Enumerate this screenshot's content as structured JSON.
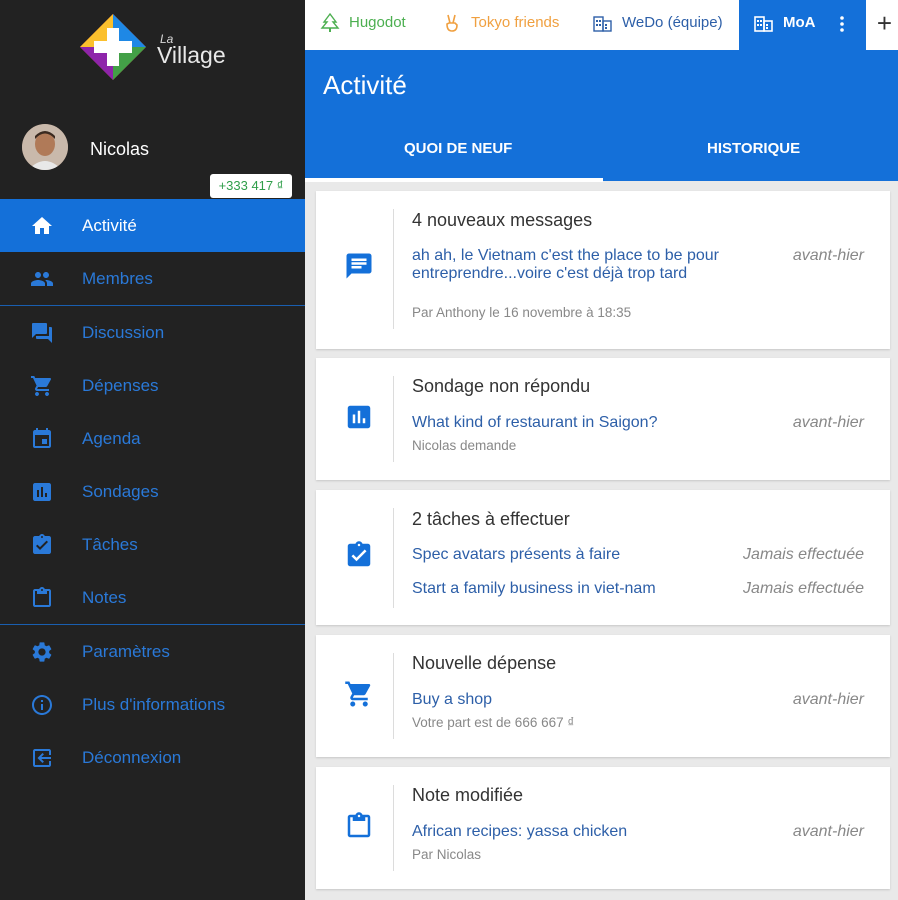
{
  "app": {
    "logo_small": "La",
    "logo_text": "Village"
  },
  "user": {
    "name": "Nicolas"
  },
  "sidebar": {
    "items": [
      {
        "label": "Activité",
        "icon": "home-icon"
      },
      {
        "label": "Membres",
        "icon": "people-icon"
      },
      {
        "label": "Discussion",
        "icon": "forum-icon"
      },
      {
        "label": "Dépenses",
        "icon": "cart-icon",
        "badge": "+333 417 ₫"
      },
      {
        "label": "Agenda",
        "icon": "calendar-icon"
      },
      {
        "label": "Sondages",
        "icon": "poll-icon"
      },
      {
        "label": "Tâches",
        "icon": "task-icon"
      },
      {
        "label": "Notes",
        "icon": "clipboard-icon"
      },
      {
        "label": "Paramètres",
        "icon": "gear-icon"
      },
      {
        "label": "Plus d'informations",
        "icon": "info-icon"
      },
      {
        "label": "Déconnexion",
        "icon": "logout-icon"
      }
    ]
  },
  "workspace_tabs": [
    {
      "label": "Hugodot",
      "color": "#4caf50",
      "icon": "tree-icon"
    },
    {
      "label": "Tokyo friends",
      "color": "#f0a040",
      "icon": "peace-hand-icon"
    },
    {
      "label": "WeDo (équipe)",
      "color": "#2d5fa8",
      "icon": "building-icon"
    },
    {
      "label": "MoA",
      "color": "#ffffff",
      "icon": "building-icon"
    }
  ],
  "add_tab_label": "+",
  "header": {
    "title": "Activité",
    "tabs": [
      "QUOI DE NEUF",
      "HISTORIQUE"
    ]
  },
  "colors": {
    "accent": "#1470d9",
    "sidebar_bg": "#222222",
    "link": "#2d5fa8",
    "badge_text": "#2f9e4a"
  },
  "cards": [
    {
      "title": "4 nouveaux messages",
      "icon": "message-icon",
      "link": "ah ah, le Vietnam c'est the place to be pour entreprendre...voire c'est déjà trop tard",
      "date": "avant-hier",
      "sub": "Par Anthony le 16 novembre à 18:35"
    },
    {
      "title": "Sondage non répondu",
      "icon": "poll-icon",
      "link": "What kind of restaurant in Saigon?",
      "date": "avant-hier",
      "sub": "Nicolas demande"
    },
    {
      "title": "2 tâches à effectuer",
      "icon": "task-icon",
      "tasks": [
        {
          "label": "Spec avatars présents à faire",
          "status": "Jamais effectuée"
        },
        {
          "label": "Start a family business in viet-nam",
          "status": "Jamais effectuée"
        }
      ]
    },
    {
      "title": "Nouvelle dépense",
      "icon": "cart-icon",
      "link": "Buy a shop",
      "date": "avant-hier",
      "sub": "Votre part est de 666 667 ₫"
    },
    {
      "title": "Note modifiée",
      "icon": "clipboard-icon",
      "link": "African recipes: yassa chicken",
      "date": "avant-hier",
      "sub": "Par Nicolas"
    }
  ]
}
